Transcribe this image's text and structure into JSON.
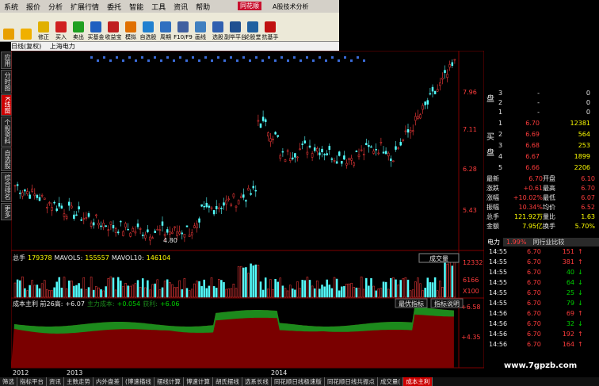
{
  "menu": [
    "系统",
    "报价",
    "分析",
    "扩展行情",
    "委托",
    "智能",
    "工具",
    "资讯",
    "帮助"
  ],
  "brand": "同花顺",
  "app_title": "A股技术分析",
  "toolbar": [
    {
      "label": "",
      "icon": "grid-icon",
      "color": "#e8a000"
    },
    {
      "label": "",
      "icon": "back-arrow-icon",
      "color": "#f0b000"
    },
    {
      "label": "修正",
      "icon": "fix-icon",
      "color": "#e0b000"
    },
    {
      "label": "买入",
      "icon": "buy-icon",
      "color": "#d02020"
    },
    {
      "label": "卖出",
      "icon": "sell-icon",
      "color": "#20a020"
    },
    {
      "label": "买基金",
      "icon": "fund-icon",
      "color": "#2060c0"
    },
    {
      "label": "收益宝",
      "icon": "treasure-icon",
      "color": "#c02020"
    },
    {
      "label": "模拟",
      "icon": "simulate-icon",
      "color": "#e07000"
    },
    {
      "label": "自选股",
      "icon": "watchlist-icon",
      "color": "#2080d0"
    },
    {
      "label": "周期",
      "icon": "clock-icon",
      "color": "#3070c0"
    },
    {
      "label": "F10/F9",
      "icon": "f10-icon",
      "color": "#4060a0"
    },
    {
      "label": "画线",
      "icon": "draw-icon",
      "color": "#4080c0"
    },
    {
      "label": "选股",
      "icon": "select-icon",
      "color": "#3060b0"
    },
    {
      "label": "副毕平台",
      "icon": "platform-icon",
      "color": "#205090"
    },
    {
      "label": "论股堂",
      "icon": "discuss-icon",
      "color": "#2060a0"
    },
    {
      "label": "抗基手",
      "icon": "high-icon",
      "color": "#c01010"
    }
  ],
  "status_line": [
    "日线(复权)",
    "上海电力"
  ],
  "left_tabs": [
    {
      "label": "应用",
      "active": false
    },
    {
      "label": "分时图",
      "active": false
    },
    {
      "label": "K线图",
      "active": true
    },
    {
      "label": "个股资料",
      "active": false
    },
    {
      "label": "自选股",
      "active": false
    },
    {
      "label": "综合排名",
      "active": false
    },
    {
      "label": "更多",
      "active": false
    }
  ],
  "price_axis": [
    "7.96",
    "7.11",
    "6.28",
    "5.43"
  ],
  "low_marker": "4.80",
  "vol_header": {
    "label": "总手",
    "total": "179378",
    "ma5_label": "MAVOL5:",
    "ma5": "155557",
    "ma10_label": "MAVOL10:",
    "ma10": "146104"
  },
  "vol_dropdown": "成交量",
  "vol_axis": [
    "12332",
    "6166",
    "X100"
  ],
  "cost_header": {
    "label": "成本主利 前26高:",
    "val": "+6.07",
    "main_label": "主力成本:",
    "main": "+0.054",
    "profit_label": "获利:",
    "profit": "+6.06"
  },
  "cost_buttons": [
    "最优指标",
    "指标说明"
  ],
  "cost_axis": [
    "+6.58",
    "+4.35"
  ],
  "years": [
    "2012",
    "2013",
    "2014"
  ],
  "sell_orders": [
    {
      "side": "卖",
      "lvl": "3",
      "price": "-",
      "vol": "0"
    },
    {
      "side": "",
      "lvl": "2",
      "price": "-",
      "vol": "0"
    },
    {
      "side": "",
      "lvl": "1",
      "price": "-",
      "vol": "0"
    }
  ],
  "sell_label": "盘",
  "buy_orders": [
    {
      "lvl": "1",
      "price": "6.70",
      "vol": "12381"
    },
    {
      "lvl": "2",
      "price": "6.69",
      "vol": "564"
    },
    {
      "lvl": "3",
      "price": "6.68",
      "vol": "253"
    },
    {
      "lvl": "4",
      "price": "6.67",
      "vol": "1899"
    },
    {
      "lvl": "5",
      "price": "6.66",
      "vol": "2206"
    }
  ],
  "buy_labels": [
    "买",
    "盘"
  ],
  "quote": [
    {
      "k1": "最新",
      "v1": "6.70",
      "k2": "开盘",
      "v2": "6.10"
    },
    {
      "k1": "涨跌",
      "v1": "+0.61",
      "k2": "最高",
      "v2": "6.70"
    },
    {
      "k1": "涨幅",
      "v1": "+10.02%",
      "k2": "最低",
      "v2": "6.07"
    },
    {
      "k1": "振幅",
      "v1": "10.34%",
      "k2": "均价",
      "v2": "6.52"
    },
    {
      "k1": "总手",
      "v1": "121.92万",
      "k2": "量比",
      "v2": "1.63"
    },
    {
      "k1": "金额",
      "v1": "7.95亿",
      "k2": "换手",
      "v2": "5.70%"
    }
  ],
  "panel_tabs": [
    "电力",
    "1.99%",
    "同行业比较"
  ],
  "ticks": [
    {
      "t": "14:55",
      "p": "6.70",
      "v": "151",
      "d": "up"
    },
    {
      "t": "14:55",
      "p": "6.70",
      "v": "381",
      "d": "up"
    },
    {
      "t": "14:55",
      "p": "6.70",
      "v": "40",
      "d": "down"
    },
    {
      "t": "14:55",
      "p": "6.70",
      "v": "64",
      "d": "down"
    },
    {
      "t": "14:55",
      "p": "6.70",
      "v": "25",
      "d": "down"
    },
    {
      "t": "14:55",
      "p": "6.70",
      "v": "79",
      "d": "down"
    },
    {
      "t": "14:56",
      "p": "6.70",
      "v": "69",
      "d": "up"
    },
    {
      "t": "14:56",
      "p": "6.70",
      "v": "32",
      "d": "down"
    },
    {
      "t": "14:56",
      "p": "6.70",
      "v": "192",
      "d": "up"
    },
    {
      "t": "14:56",
      "p": "6.70",
      "v": "164",
      "d": "up"
    }
  ],
  "bottom_tabs": [
    "筛选",
    "指标平台",
    "资讯",
    "主数走势",
    "内外盘差",
    "(博速描线",
    "摆线计算",
    "博速计算",
    "胡氏摆线",
    "选系长线",
    "同花顺日线极速版",
    "同花顺日线共振点",
    "成交量(",
    {
      "active": "成本主利"
    }
  ],
  "watermark": "www.7gpzb.com",
  "colors": {
    "red": "#ff3c3c",
    "green": "#00d200",
    "bg": "#000000"
  }
}
